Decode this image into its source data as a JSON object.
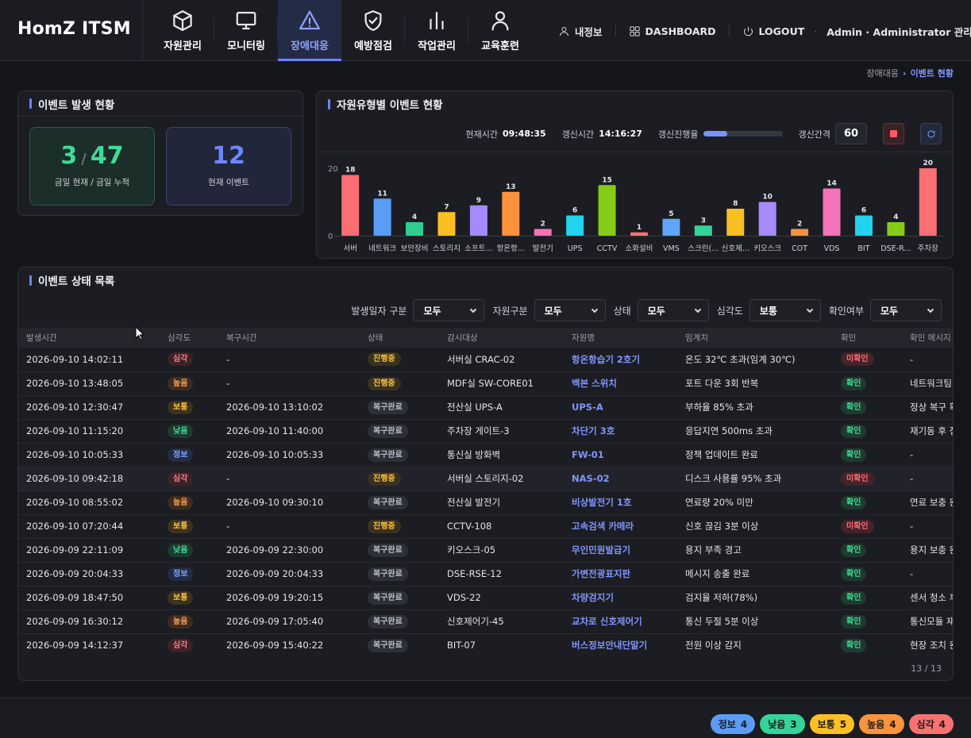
{
  "app": {
    "title": "HomZ ITSM"
  },
  "nav": [
    {
      "label": "자원관리",
      "icon": "cube-icon",
      "active": false
    },
    {
      "label": "모니터링",
      "icon": "monitor-icon",
      "active": false
    },
    {
      "label": "장애대응",
      "icon": "warning-icon",
      "active": true
    },
    {
      "label": "예방점검",
      "icon": "shield-check-icon",
      "active": false
    },
    {
      "label": "작업관리",
      "icon": "bar-chart-icon",
      "active": false
    },
    {
      "label": "교육훈련",
      "icon": "user-icon",
      "active": false
    }
  ],
  "header": {
    "myinfo": "내정보",
    "dashboard": "DASHBOARD",
    "logout": "LOGOUT",
    "admin": "Admin · Administrator 관리자"
  },
  "breadcrumb": {
    "parent": "장애대응",
    "separator": "›",
    "current": "이벤트 현황"
  },
  "occurrence": {
    "title": "이벤트 발생 현황",
    "today": "3",
    "slash": "/",
    "total": "47",
    "today_label": "금일 현재 / 금일 누적",
    "current": "12",
    "current_label": "현재 이벤트"
  },
  "chart_panel": {
    "title": "자원유형별 이벤트 현황",
    "now_label": "현재시간",
    "now_value": "09:48:35",
    "refresh_label": "갱신시간",
    "refresh_value": "14:16:27",
    "progress_label": "갱신진행율",
    "progress": 0.3,
    "interval_label": "갱신간격",
    "interval_value": "60"
  },
  "chart_data": {
    "type": "bar",
    "categories": [
      "서버",
      "네트워크",
      "보안장비",
      "스토리지",
      "소프트...",
      "항온항...",
      "발전기",
      "UPS",
      "CCTV",
      "소화설비",
      "VMS",
      "스크린(...",
      "신호제...",
      "키오스크",
      "COT",
      "VDS",
      "BIT",
      "DSE-R...",
      "주차장"
    ],
    "values": [
      18,
      11,
      4,
      7,
      9,
      13,
      2,
      6,
      15,
      1,
      5,
      3,
      8,
      10,
      2,
      14,
      6,
      4,
      20
    ],
    "colors": [
      "#fb6f73",
      "#5b9cf6",
      "#2fce90",
      "#fbbf24",
      "#a58bfa",
      "#fb923c",
      "#f472b6",
      "#22d3ee",
      "#84cc16",
      "#f87171",
      "#60a5fa",
      "#34d399",
      "#fbbf24",
      "#a78bfa",
      "#fb923c",
      "#f472b6",
      "#22d3ee",
      "#84cc16",
      "#fb6f73"
    ],
    "ylim": [
      0,
      20
    ],
    "yticks": [
      "20",
      "0"
    ],
    "title": "",
    "xlabel": "",
    "ylabel": ""
  },
  "list": {
    "title": "이벤트 상태 목록",
    "filters": [
      {
        "label": "발생일자 구분",
        "value": "모두"
      },
      {
        "label": "자원구분",
        "value": "모두"
      },
      {
        "label": "상태",
        "value": "모두"
      },
      {
        "label": "심각도",
        "value": "보통"
      },
      {
        "label": "확인여부",
        "value": "모두"
      }
    ],
    "columns": [
      "발생시간",
      "심각도",
      "복구시간",
      "상태",
      "감시대상",
      "자원명",
      "임계치",
      "확인",
      "확인 메시지"
    ],
    "rows": [
      {
        "time": "2026-09-10 14:02:11",
        "severity": "심각",
        "recovery": "-",
        "status": "진행중",
        "target": "서버실 CRAC-02",
        "resource": "항온항습기 2호기",
        "threshold": "온도 32℃ 초과(임계 30℃)",
        "check": "미확인",
        "message": "-"
      },
      {
        "time": "2026-09-10 13:48:05",
        "severity": "높음",
        "recovery": "-",
        "status": "진행중",
        "target": "MDF실 SW-CORE01",
        "resource": "백본 스위치",
        "threshold": "포트 다운 3회 반복",
        "check": "확인",
        "message": "네트워크팀 확인중"
      },
      {
        "time": "2026-09-10 12:30:47",
        "severity": "보통",
        "recovery": "2026-09-10 13:10:02",
        "status": "복구완료",
        "target": "전산실 UPS-A",
        "resource": "UPS-A",
        "threshold": "부하율 85% 초과",
        "check": "확인",
        "message": "정상 복구 확인"
      },
      {
        "time": "2026-09-10 11:15:20",
        "severity": "낮음",
        "recovery": "2026-09-10 11:40:00",
        "status": "복구완료",
        "target": "주차장 게이트-3",
        "resource": "차단기 3호",
        "threshold": "응답지연 500ms 초과",
        "check": "확인",
        "message": "재기동 후 정상"
      },
      {
        "time": "2026-09-10 10:05:33",
        "severity": "정보",
        "recovery": "2026-09-10 10:05:33",
        "status": "복구완료",
        "target": "통신실 방화벽",
        "resource": "FW-01",
        "threshold": "정책 업데이트 완료",
        "check": "확인",
        "message": "-"
      },
      {
        "time": "2026-09-10 09:42:18",
        "severity": "심각",
        "recovery": "-",
        "status": "진행중",
        "target": "서버실 스토리지-02",
        "resource": "NAS-02",
        "threshold": "디스크 사용률 95% 초과",
        "check": "미확인",
        "message": "-"
      },
      {
        "time": "2026-09-10 08:55:02",
        "severity": "높음",
        "recovery": "2026-09-10 09:30:10",
        "status": "복구완료",
        "target": "전산실 발전기",
        "resource": "비상발전기 1호",
        "threshold": "연료량 20% 미만",
        "check": "확인",
        "message": "연료 보충 완료"
      },
      {
        "time": "2026-09-10 07:20:44",
        "severity": "보통",
        "recovery": "-",
        "status": "진행중",
        "target": "CCTV-108",
        "resource": "고속검색 카메라",
        "threshold": "신호 끊김 3분 이상",
        "check": "미확인",
        "message": "-"
      },
      {
        "time": "2026-09-09 22:11:09",
        "severity": "낮음",
        "recovery": "2026-09-09 22:30:00",
        "status": "복구완료",
        "target": "키오스크-05",
        "resource": "무인민원발급기",
        "threshold": "용지 부족 경고",
        "check": "확인",
        "message": "용지 보충 완료"
      },
      {
        "time": "2026-09-09 20:04:33",
        "severity": "정보",
        "recovery": "2026-09-09 20:04:33",
        "status": "복구완료",
        "target": "DSE-RSE-12",
        "resource": "가변전광표지판",
        "threshold": "메시지 송출 완료",
        "check": "확인",
        "message": "-"
      },
      {
        "time": "2026-09-09 18:47:50",
        "severity": "보통",
        "recovery": "2026-09-09 19:20:15",
        "status": "복구완료",
        "target": "VDS-22",
        "resource": "차량검지기",
        "threshold": "검지율 저하(78%)",
        "check": "확인",
        "message": "센서 청소 후 정상"
      },
      {
        "time": "2026-09-09 16:30:12",
        "severity": "높음",
        "recovery": "2026-09-09 17:05:40",
        "status": "복구완료",
        "target": "신호제어기-45",
        "resource": "교차로 신호제어기",
        "threshold": "통신 두절 5분 이상",
        "check": "확인",
        "message": "통신모듈 재기동"
      },
      {
        "time": "2026-09-09 14:12:37",
        "severity": "심각",
        "recovery": "2026-09-09 15:40:22",
        "status": "복구완료",
        "target": "BIT-07",
        "resource": "버스정보안내단말기",
        "threshold": "전원 이상 감지",
        "check": "확인",
        "message": "현장 조치 완료"
      }
    ],
    "pager": "13 / 13"
  },
  "legend": [
    {
      "label": "정보",
      "count": "4",
      "color": "#5b9cf6"
    },
    {
      "label": "낮음",
      "count": "3",
      "color": "#34d399"
    },
    {
      "label": "보통",
      "count": "5",
      "color": "#fbbf24"
    },
    {
      "label": "높음",
      "count": "4",
      "color": "#fb923c"
    },
    {
      "label": "심각",
      "count": "4",
      "color": "#f87171"
    }
  ]
}
